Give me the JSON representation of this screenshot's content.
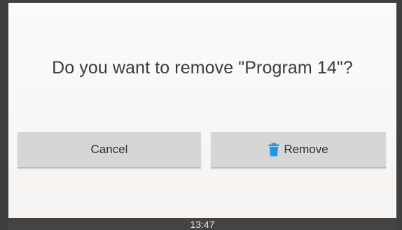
{
  "dialog": {
    "message": "Do you want to remove \"Program 14\"?",
    "cancel_label": "Cancel",
    "remove_label": "Remove"
  },
  "icons": {
    "remove_icon": "trash-icon"
  },
  "colors": {
    "accent": "#1e9be8",
    "button_bg": "#d6d6d6",
    "status_bar_bg": "#444444"
  },
  "status_bar": {
    "time": "13:47"
  }
}
